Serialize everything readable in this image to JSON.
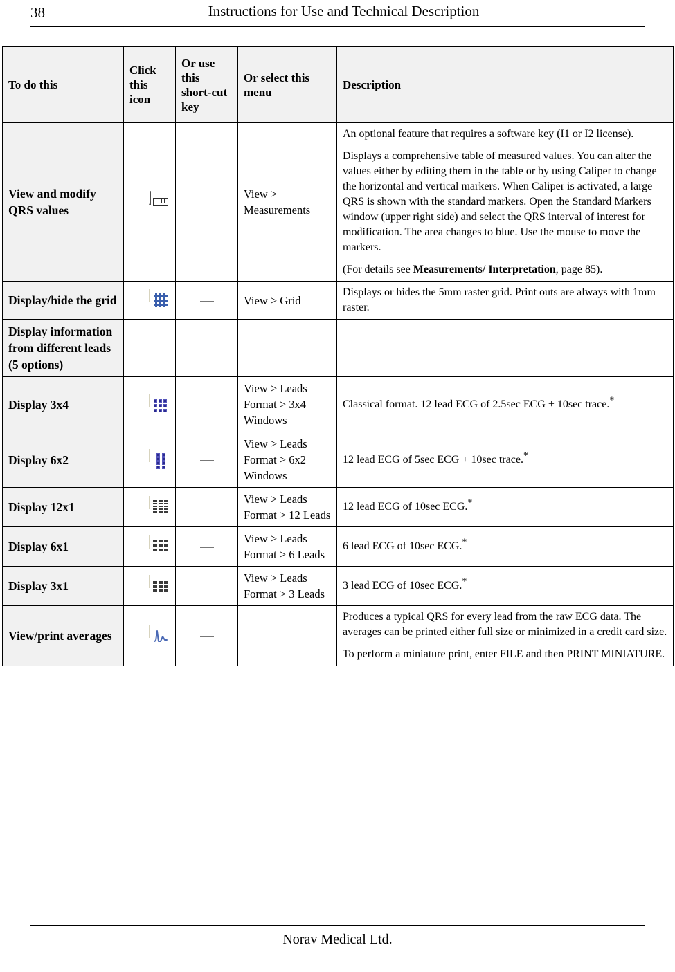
{
  "header": {
    "page_number": "38",
    "title": "Instructions for Use and Technical Description"
  },
  "footer": {
    "company": "Norav Medical Ltd."
  },
  "table": {
    "columns": [
      "To do this",
      "Click this icon",
      "Or use this short-cut key",
      "Or select this menu",
      "Description"
    ],
    "rows": [
      {
        "todo": "View and modify QRS values",
        "icon": "ruler-icon",
        "shortcut": "—",
        "menu": "View > Measurements",
        "desc_paragraphs": [
          "An optional feature that requires a software key (I1 or I2 license).",
          "Displays a comprehensive table of measured values. You can alter the values either by editing them in the table or by using Caliper to change the horizontal and vertical markers. When Caliper is activated, a large QRS is shown with the standard markers. Open the Standard Markers window (upper right side) and select the QRS interval of interest for modification. The area changes to blue. Use the mouse to move the markers."
        ],
        "desc_reference_prefix": "(For details see ",
        "desc_reference_bold": "Measurements/ Interpretation",
        "desc_reference_suffix": ", page 85)."
      },
      {
        "todo": "Display/hide the grid",
        "icon": "grid-icon",
        "shortcut": "—",
        "menu": "View > Grid",
        "desc_paragraphs": [
          "Displays or hides the 5mm raster grid. Print outs are always with 1mm raster."
        ]
      },
      {
        "todo": "Display information from different leads (5 options)",
        "icon": "",
        "shortcut": "",
        "menu": "",
        "desc_paragraphs": []
      },
      {
        "todo": "Display 3x4",
        "icon": "layout-3x4-icon",
        "shortcut": "—",
        "menu": "View > Leads Format > 3x4 Windows",
        "desc_text": "Classical format. 12 lead ECG of 2.5sec ECG + 10sec trace.",
        "desc_superscript": "*"
      },
      {
        "todo": "Display 6x2",
        "icon": "layout-6x2-icon",
        "shortcut": "—",
        "menu": "View > Leads Format > 6x2 Windows",
        "desc_text": "12 lead ECG of 5sec ECG + 10sec trace.",
        "desc_superscript": "*"
      },
      {
        "todo": "Display 12x1",
        "icon": "layout-12x1-icon",
        "shortcut": "—",
        "menu": "View > Leads Format > 12 Leads",
        "desc_text": "12 lead ECG of 10sec ECG.",
        "desc_superscript": "*"
      },
      {
        "todo": "Display 6x1",
        "icon": "layout-6x1-icon",
        "shortcut": "—",
        "menu": "View > Leads Format > 6 Leads",
        "desc_text": "6 lead ECG of 10sec ECG.",
        "desc_superscript": "*"
      },
      {
        "todo": "Display 3x1",
        "icon": "layout-3x1-icon",
        "shortcut": "—",
        "menu": "View > Leads Format > 3 Leads",
        "desc_text": "3 lead ECG of 10sec ECG.",
        "desc_superscript": "*"
      },
      {
        "todo": "View/print averages",
        "icon": "ecg-average-icon",
        "shortcut": "—",
        "menu": "",
        "desc_paragraphs": [
          "Produces a typical QRS for every lead from the raw ECG data. The averages can be printed either full size or minimized in a credit card size.",
          "To perform a miniature print, enter FILE and then PRINT MINIATURE."
        ]
      }
    ]
  },
  "colors": {
    "header_shade": "#F1F1F1",
    "icon_blue": "#2B2B8F",
    "icon_cream": "#EAE7D5",
    "border": "#000000"
  }
}
